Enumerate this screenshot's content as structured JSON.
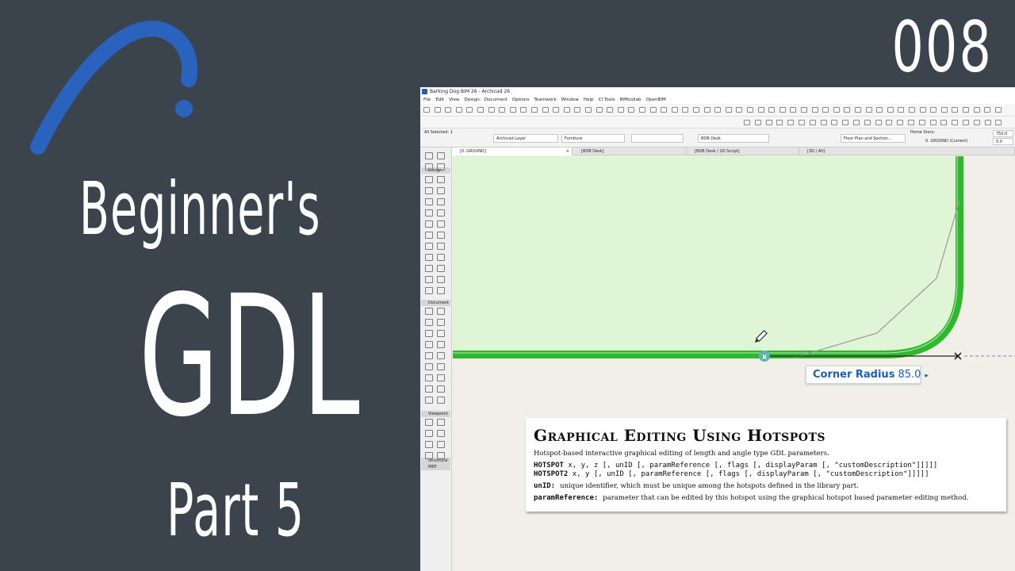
{
  "title_card": {
    "line1": "Beginner's",
    "line2": "GDL",
    "line3": "Part 5",
    "episode": "008"
  },
  "colors": {
    "background": "#3b444c",
    "logo_blue": "#2a63bd",
    "fill_green": "#dff5d6",
    "wall_green": "#2db82d",
    "hotspot_teal": "#5fb3a8",
    "tip_blue": "#1c5fb8"
  },
  "app": {
    "window_title": "Barking Dog BIM 26 - Archicad 26",
    "menu": [
      "File",
      "Edit",
      "View",
      "Design",
      "Document",
      "Options",
      "Teamwork",
      "Window",
      "Help",
      "CI Tools",
      "BIMcollab",
      "OpenBIM"
    ],
    "infobox": {
      "selection": "All Selected: 1",
      "layer": "Archicad Layer",
      "category": "Furniture",
      "object_name": "BDB Desk",
      "view": "Floor Plan and Section...",
      "home_story_label": "Home Story:",
      "home_story": "0. GROUND (Current)",
      "elevation_1": "750.0",
      "elevation_2": "0.0"
    },
    "tabs": [
      "[0. GROUND]",
      "[BDB Desk]",
      "[BDB Desk / 2D Script]",
      "[3D / All]"
    ],
    "toolbox_sections": [
      "Design",
      "Document",
      "Viewpoint",
      "Structural",
      "MEP"
    ],
    "toolbox_icons": [
      "arrow-icon",
      "marquee-icon",
      "wall-icon",
      "column-icon",
      "beam-icon",
      "window-icon",
      "door-icon",
      "object-icon",
      "slab-icon",
      "roof-icon",
      "stair-icon",
      "railing-icon",
      "mesh-icon",
      "zone-icon",
      "dimension-icon",
      "level-icon",
      "text-icon",
      "label-icon",
      "line-icon",
      "arc-icon",
      "polyline-icon",
      "fill-icon",
      "figure-icon",
      "camera-icon"
    ]
  },
  "editor": {
    "corner_radius_label": "Corner Radius",
    "corner_radius_value": "85.0",
    "corner_radius_arrow": "▸"
  },
  "doc": {
    "title": "Graphical Editing Using Hotspots",
    "description": "Hotspot-based interactive graphical editing of length and angle type GDL parameters.",
    "syntax": [
      {
        "keyword": "HOTSPOT",
        "args": " x, y, z [, unID [, paramReference [, flags [, displayParam [, \"customDescription\"]]]]]"
      },
      {
        "keyword": "HOTSPOT2",
        "args": " x, y [, unID [, paramReference [, flags [, displayParam [, \"customDescription\"]]]]]"
      }
    ],
    "params": [
      {
        "name": "unID:",
        "text": "unique identifier, which must be unique among the hotspots defined in the library part."
      },
      {
        "name": "paramReference:",
        "text": "parameter that can be edited by this hotspot using the graphical hotspot based parameter editing method."
      }
    ]
  }
}
